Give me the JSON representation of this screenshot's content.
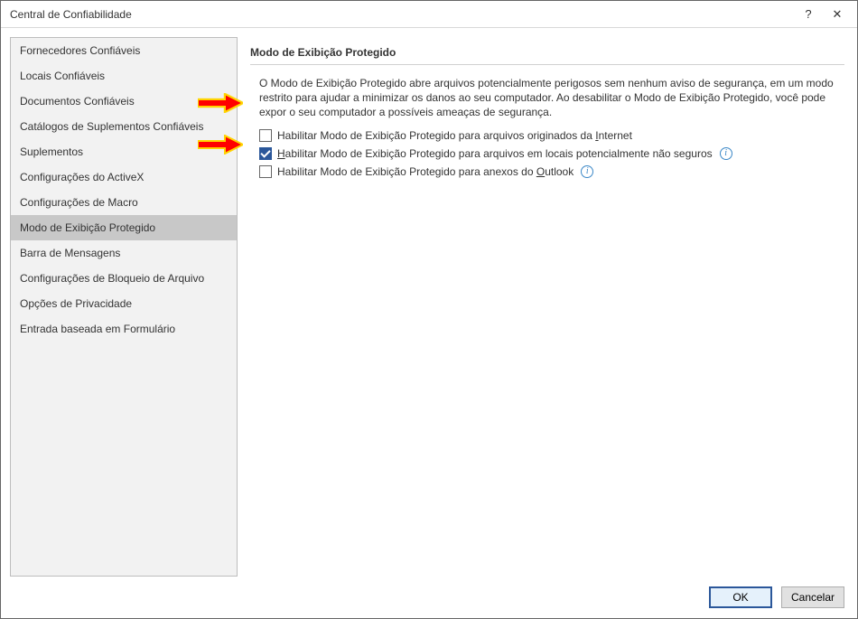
{
  "window": {
    "title": "Central de Confiabilidade"
  },
  "titlebar": {
    "help": "?",
    "close": "✕"
  },
  "sidebar": {
    "items": [
      {
        "label": "Fornecedores Confiáveis"
      },
      {
        "label": "Locais Confiáveis"
      },
      {
        "label": "Documentos Confiáveis"
      },
      {
        "label": "Catálogos de Suplementos Confiáveis"
      },
      {
        "label": "Suplementos"
      },
      {
        "label": "Configurações do ActiveX"
      },
      {
        "label": "Configurações de Macro"
      },
      {
        "label": "Modo de Exibição Protegido"
      },
      {
        "label": "Barra de Mensagens"
      },
      {
        "label": "Configurações de Bloqueio de Arquivo"
      },
      {
        "label": "Opções de Privacidade"
      },
      {
        "label": "Entrada baseada em Formulário"
      }
    ],
    "selected_index": 7
  },
  "main": {
    "section_title": "Modo de Exibição Protegido",
    "description": "O Modo de Exibição Protegido abre arquivos potencialmente perigosos sem nenhum aviso de segurança, em um modo restrito para ajudar a minimizar os danos ao seu computador. Ao desabilitar o Modo de Exibição Protegido, você pode expor o seu computador a possíveis ameaças de segurança.",
    "options": [
      {
        "checked": false,
        "label_pre": "Habilitar Modo de Exibição Protegido para arquivos originados da ",
        "label_u": "I",
        "label_post": "nternet",
        "has_info": false
      },
      {
        "checked": true,
        "label_pre": "",
        "label_u": "H",
        "label_post": "abilitar Modo de Exibição Protegido para arquivos em locais potencialmente não seguros",
        "has_info": true
      },
      {
        "checked": false,
        "label_pre": "Habilitar Modo de Exibição Protegido para anexos do ",
        "label_u": "O",
        "label_post": "utlook",
        "has_info": true
      }
    ]
  },
  "footer": {
    "ok": "OK",
    "cancel": "Cancelar"
  },
  "icons": {
    "info": "i"
  }
}
